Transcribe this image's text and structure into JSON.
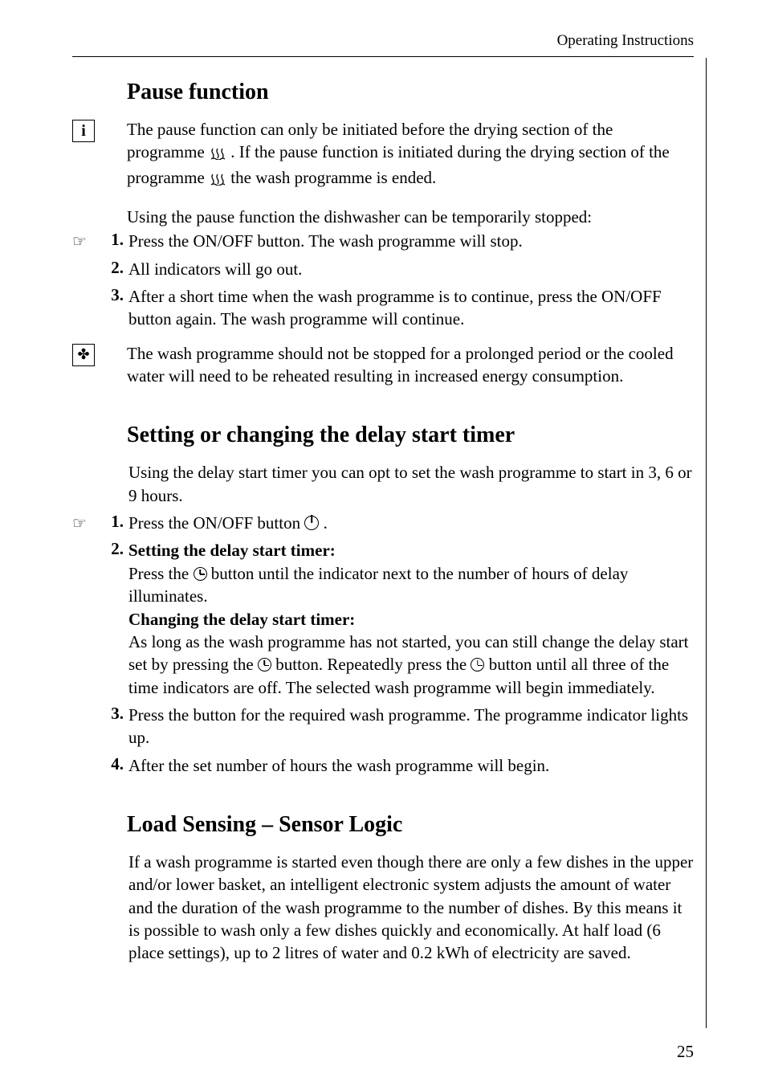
{
  "header": {
    "title": "Operating Instructions"
  },
  "sections": {
    "pause": {
      "title": "Pause function",
      "info": {
        "p1a": "The pause function can only be initiated before the drying section of the programme ",
        "p1b": ". If the pause function is initiated during the drying section of the programme ",
        "p1c": " the wash programme is ended."
      },
      "intro": "Using the pause function the dishwasher can be temporarily stopped:",
      "steps": {
        "s1": "Press the ON/OFF button. The wash programme will stop.",
        "s2": "All indicators will go out.",
        "s3": "After a short time when the wash programme is to continue, press the ON/OFF button again. The wash programme will continue."
      },
      "eco": "The wash programme should not be stopped for a prolonged period or the cooled water will need to be reheated resulting in increased energy consumption."
    },
    "delay": {
      "title": "Setting or changing the delay start timer",
      "intro": "Using the delay start timer you can opt to set the wash programme to start in 3, 6 or 9 hours.",
      "s1a": "Press the ON/OFF button ",
      "s1b": ".",
      "s2": {
        "h1": "Setting the delay start timer:",
        "p1a": "Press the ",
        "p1b": " button until the indicator next to the number of hours of delay illuminates.",
        "h2": "Changing the delay start timer:",
        "p2a": "As long as the wash programme has not started, you can still change the delay start set by pressing the ",
        "p2b": " button. Repeatedly press the ",
        "p2c": " button until all three of the time indicators are off. The selected wash programme will begin immediately."
      },
      "s3": "Press the button for the required wash programme. The programme indicator lights up.",
      "s4": "After the set number of hours the wash programme will begin."
    },
    "load": {
      "title": "Load Sensing – Sensor Logic",
      "body": "If a wash programme is started even though there are only a few dishes in the upper and/or lower basket, an intelligent electronic system adjusts the amount of water and the duration of the wash programme to the number of dishes. By this means it is possible to wash only a few dishes quickly and economically. At half load (6 place settings), up to 2 litres of water and 0.2 kWh of electricity are saved."
    }
  },
  "nums": {
    "n1": "1.",
    "n2": "2.",
    "n3": "3.",
    "n4": "4."
  },
  "page_number": "25",
  "icons": {
    "hand": "☞",
    "info": "i",
    "clover": "✤"
  }
}
